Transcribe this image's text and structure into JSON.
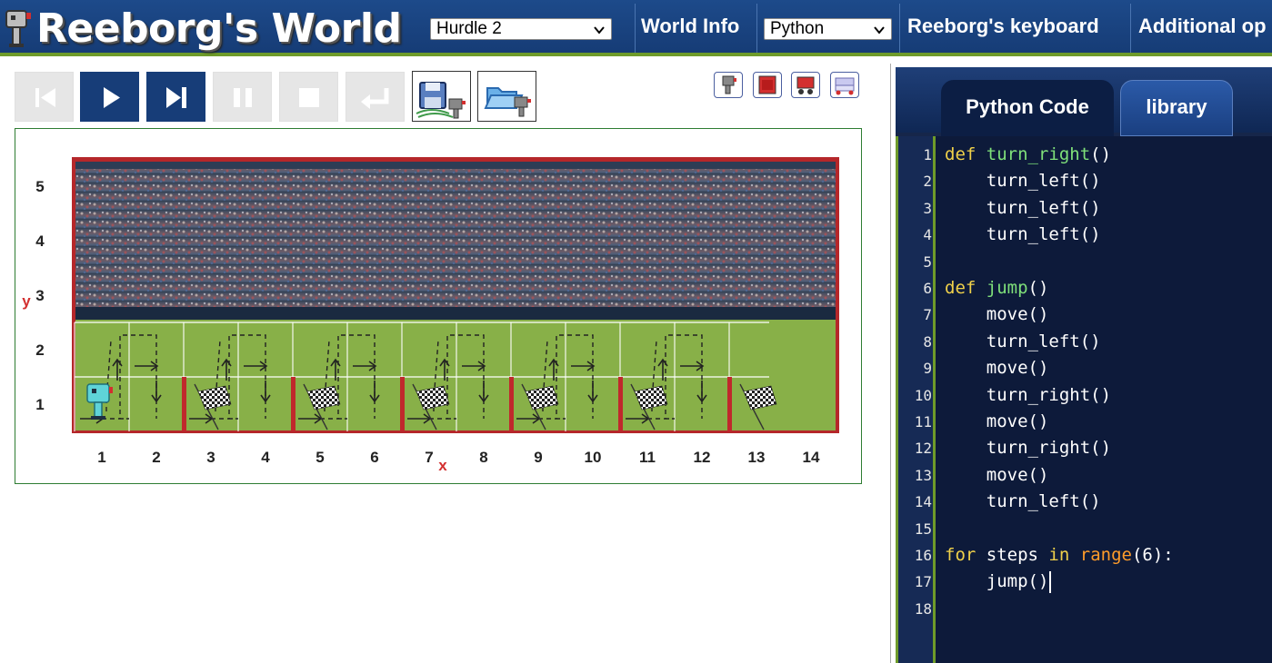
{
  "app": {
    "title": "Reeborg's World",
    "world_select": "Hurdle 2",
    "language_select": "Python",
    "links": [
      "World Info",
      "Reeborg's keyboard",
      "Additional op"
    ]
  },
  "controls": {
    "buttons": [
      {
        "name": "reload-button",
        "icon": "step-back-icon",
        "enabled": false
      },
      {
        "name": "run-button",
        "icon": "play-icon",
        "enabled": true
      },
      {
        "name": "step-button",
        "icon": "step-forward-icon",
        "enabled": true
      },
      {
        "name": "pause-button",
        "icon": "pause-icon",
        "enabled": false
      },
      {
        "name": "stop-button",
        "icon": "stop-icon",
        "enabled": false
      },
      {
        "name": "return-button",
        "icon": "return-icon",
        "enabled": false
      }
    ],
    "file_buttons": [
      "save-robot-icon",
      "open-folder-robot-icon"
    ],
    "mini_buttons": [
      "robot-icon",
      "film-icon",
      "red-robot-icon",
      "conveyor-icon"
    ]
  },
  "world": {
    "x_axis_labels": [
      "1",
      "2",
      "3",
      "4",
      "5",
      "6",
      "7",
      "8",
      "9",
      "10",
      "11",
      "12",
      "13",
      "14"
    ],
    "y_axis_labels": [
      "1",
      "2",
      "3",
      "4",
      "5"
    ],
    "x_axis_name": "x",
    "y_axis_name": "y",
    "hurdles_at_x": [
      2,
      4,
      6,
      8,
      10,
      12
    ],
    "flags_at_x": [
      3,
      5,
      7,
      9,
      11,
      13
    ],
    "robot_position": [
      1,
      1
    ],
    "background": "baseball-stadium-image",
    "colors": {
      "frame": "#b5272a",
      "wall": "#c0282c",
      "field": "#7fa840",
      "axis_marker": "#d32f2f"
    }
  },
  "editor": {
    "tabs": [
      {
        "label": "Python Code",
        "active": true
      },
      {
        "label": "library",
        "active": false
      }
    ],
    "code_lines": [
      [
        [
          "kw",
          "def"
        ],
        [
          "txt",
          " "
        ],
        [
          "fn",
          "turn_right"
        ],
        [
          "txt",
          "()"
        ]
      ],
      [
        [
          "txt",
          "    turn_left()"
        ]
      ],
      [
        [
          "txt",
          "    turn_left()"
        ]
      ],
      [
        [
          "txt",
          "    turn_left()"
        ]
      ],
      [
        [
          "txt",
          ""
        ]
      ],
      [
        [
          "kw",
          "def"
        ],
        [
          "txt",
          " "
        ],
        [
          "fn",
          "jump"
        ],
        [
          "txt",
          "()"
        ]
      ],
      [
        [
          "txt",
          "    move()"
        ]
      ],
      [
        [
          "txt",
          "    turn_left()"
        ]
      ],
      [
        [
          "txt",
          "    move()"
        ]
      ],
      [
        [
          "txt",
          "    turn_right()"
        ]
      ],
      [
        [
          "txt",
          "    move()"
        ]
      ],
      [
        [
          "txt",
          "    turn_right()"
        ]
      ],
      [
        [
          "txt",
          "    move()"
        ]
      ],
      [
        [
          "txt",
          "    turn_left()"
        ]
      ],
      [
        [
          "txt",
          ""
        ]
      ],
      [
        [
          "kw",
          "for"
        ],
        [
          "txt",
          " steps "
        ],
        [
          "kw",
          "in"
        ],
        [
          "txt",
          " "
        ],
        [
          "bi",
          "range"
        ],
        [
          "txt",
          "("
        ],
        [
          "num",
          "6"
        ],
        [
          "txt",
          "):"
        ]
      ],
      [
        [
          "txt",
          "    jump()"
        ]
      ],
      [
        [
          "txt",
          ""
        ]
      ]
    ],
    "cursor_line": 17
  }
}
